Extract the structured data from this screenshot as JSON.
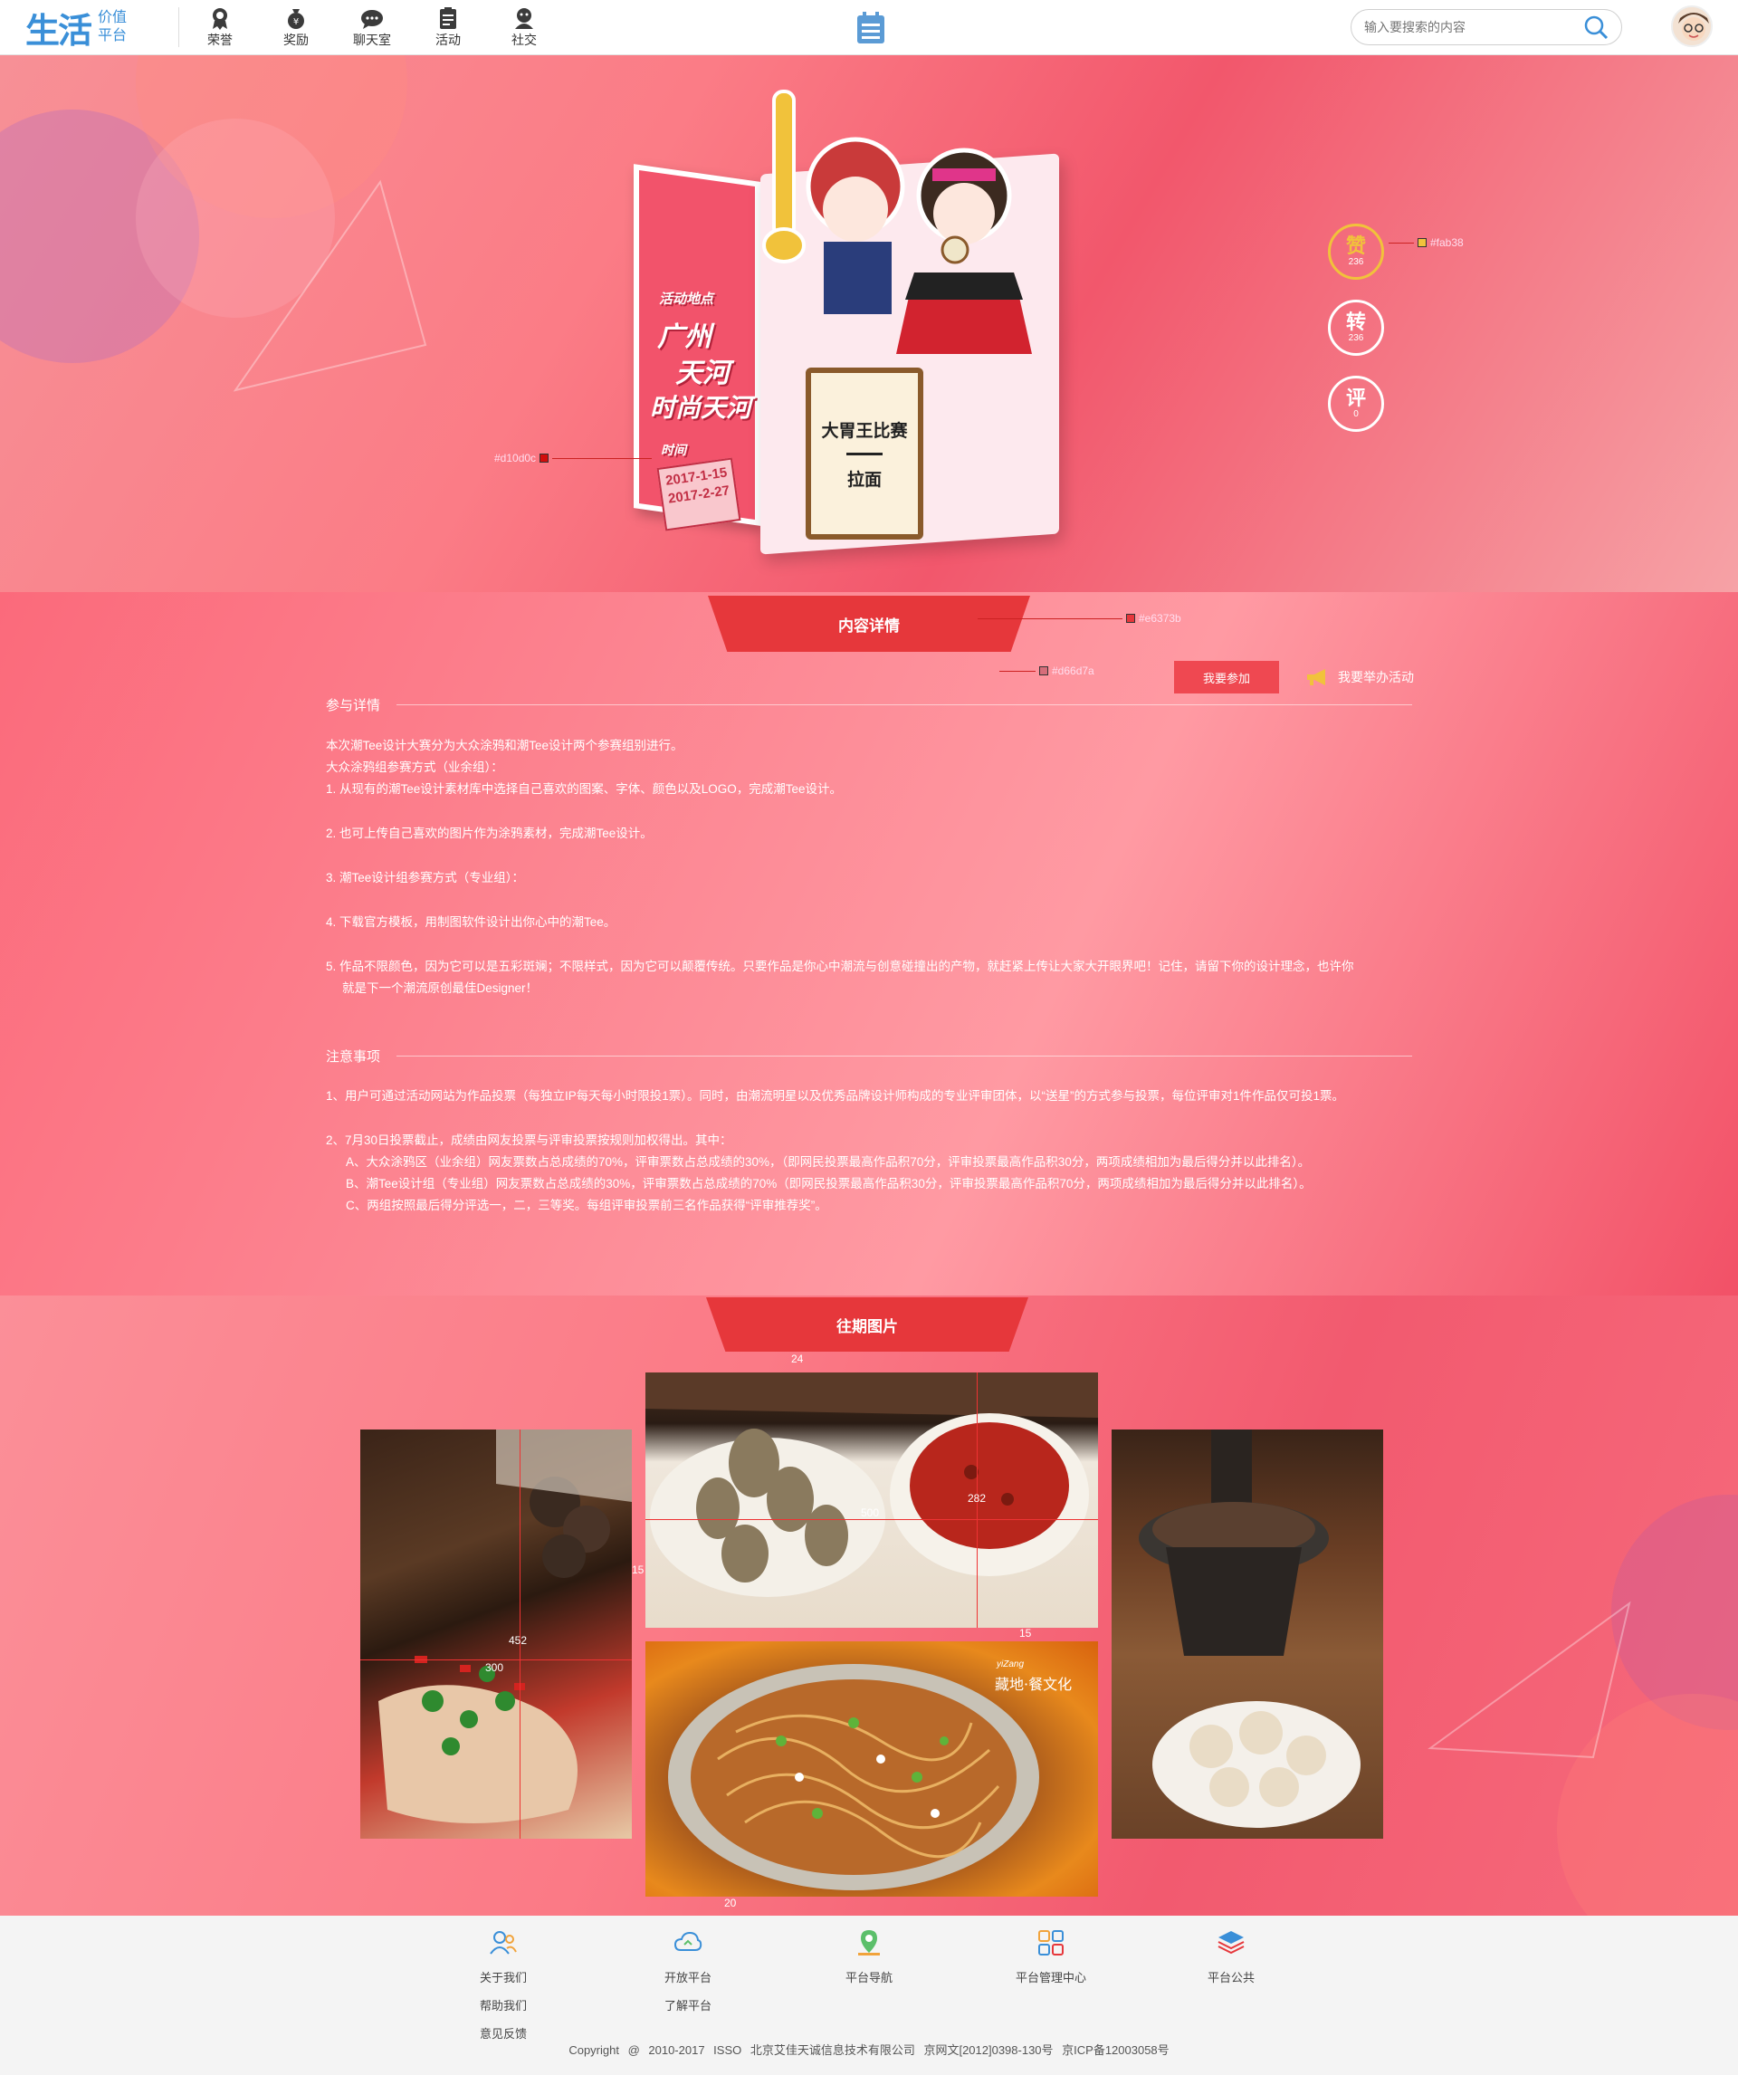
{
  "header": {
    "logo_main": "生活",
    "logo_sub_1": "价值",
    "logo_sub_2": "平台",
    "nav": [
      {
        "label": "荣誉",
        "icon": "medal-icon"
      },
      {
        "label": "奖励",
        "icon": "money-bag-icon"
      },
      {
        "label": "聊天室",
        "icon": "chat-icon"
      },
      {
        "label": "活动",
        "icon": "clipboard-icon"
      },
      {
        "label": "社交",
        "icon": "social-icon"
      }
    ],
    "search_placeholder": "输入要搜索的内容"
  },
  "hero": {
    "board_heading": "活动地点",
    "board_line1": "广州",
    "board_line2": "天河",
    "board_line3": "时尚天河",
    "time_label": "时间",
    "date_start": "2017-1-15",
    "date_end": "2017-2-27",
    "scroll_title": "大胃王比赛",
    "scroll_sub": "拉面",
    "like": {
      "label": "赞",
      "count": "236"
    },
    "share": {
      "label": "转",
      "count": "236"
    },
    "comment": {
      "label": "评",
      "count": "0"
    },
    "annotations": {
      "like_color": "#fab38",
      "board_color": "#d10d0c"
    }
  },
  "content": {
    "tab_label": "内容详情",
    "annotations": {
      "tab_color": "#e6373b",
      "tab_shadow": "#d66d7a"
    },
    "join_button": "我要参加",
    "host_link": "我要举办活动",
    "section1_title": "参与详情",
    "section1_lines": [
      "本次潮Tee设计大赛分为大众涂鸦和潮Tee设计两个参赛组别进行。",
      "大众涂鸦组参赛方式（业余组）：",
      "1. 从现有的潮Tee设计素材库中选择自己喜欢的图案、字体、颜色以及LOGO，完成潮Tee设计。",
      "2. 也可上传自己喜欢的图片作为涂鸦素材，完成潮Tee设计。",
      "3. 潮Tee设计组参赛方式（专业组）：",
      "4. 下载官方模板，用制图软件设计出你心中的潮Tee。",
      "5. 作品不限颜色，因为它可以是五彩斑斓；不限样式，因为它可以颠覆传统。只要作品是你心中潮流与创意碰撞出的产物，就赶紧上传让大家大开眼界吧！记住，请留下你的设计理念，也许你",
      "就是下一个潮流原创最佳Designer！"
    ],
    "section2_title": "注意事项",
    "section2_lines": [
      "1、用户可通过活动网站为作品投票（每独立IP每天每小时限投1票）。同时，由潮流明星以及优秀品牌设计师构成的专业评审团体，以“送星”的方式参与投票，每位评审对1件作品仅可投1票。",
      "2、7月30日投票截止，成绩由网友投票与评审投票按规则加权得出。其中：",
      "A、大众涂鸦区（业余组）网友票数占总成绩的70%，评审票数占总成绩的30%，（即网民投票最高作品积70分，评审投票最高作品积30分，两项成绩相加为最后得分并以此排名）。",
      "B、潮Tee设计组（专业组）网友票数占总成绩的30%，评审票数占总成绩的70%（即网民投票最高作品积30分，评审投票最高作品积70分，两项成绩相加为最后得分并以此排名）。",
      "C、两组按照最后得分评选一，二，三等奖。每组评审投票前三名作品获得“评审推荐奖”。"
    ]
  },
  "gallery": {
    "title": "往期图片",
    "measures": {
      "top": "24",
      "width": "500",
      "height": "282",
      "gap_h": "15",
      "gap_v": "15",
      "left_h": "452",
      "left_w": "300",
      "bottom": "20"
    },
    "photo_caption": "藏地·餐文化",
    "photo_caption_small": "yiZang"
  },
  "footer": {
    "cols": [
      {
        "icon": "users-icon",
        "links": [
          "关于我们",
          "帮助我们",
          "意见反馈"
        ]
      },
      {
        "icon": "cloud-icon",
        "links": [
          "开放平台",
          "了解平台"
        ]
      },
      {
        "icon": "map-pin-icon",
        "links": [
          "平台导航"
        ]
      },
      {
        "icon": "grid-icon",
        "links": [
          "平台管理中心"
        ]
      },
      {
        "icon": "layers-icon",
        "links": [
          "平台公共"
        ]
      }
    ],
    "copyright": "Copyright @ 2010-2017 ISSO 北京艾佳天诚信息技术有限公司    京网文[2012]0398-130号    京ICP备12003058号"
  },
  "colors": {
    "accent": "#e6373b",
    "brand_blue": "#3a8fd8",
    "join_red": "#ef4851"
  }
}
